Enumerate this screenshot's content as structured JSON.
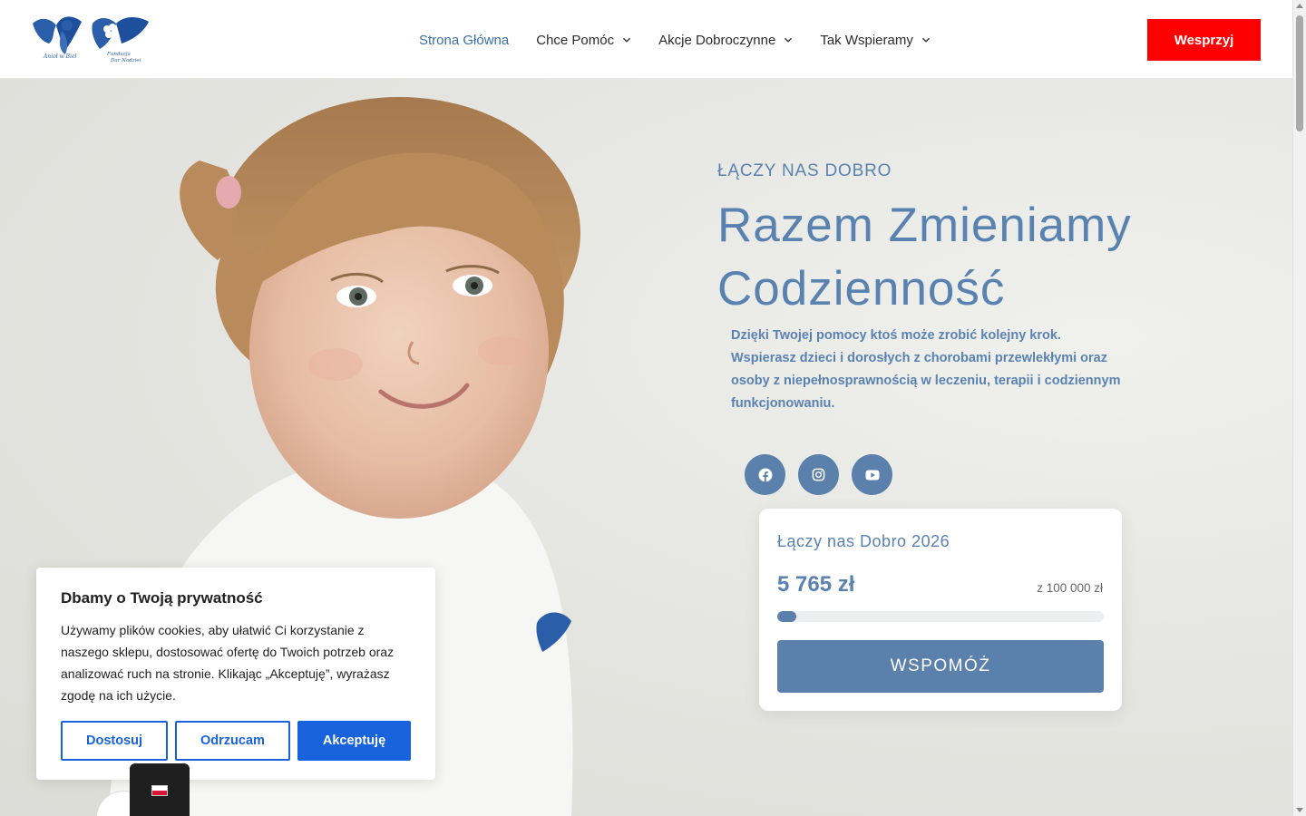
{
  "header": {
    "logo_left_caption": "Anioł w Biel",
    "logo_right_caption": "Fundacja Dar Nadziei",
    "nav": [
      {
        "label": "Strona Główna",
        "active": true,
        "dropdown": false
      },
      {
        "label": "Chce Pomóc",
        "active": false,
        "dropdown": true
      },
      {
        "label": "Akcje Dobroczynne",
        "active": false,
        "dropdown": true
      },
      {
        "label": "Tak Wspieramy",
        "active": false,
        "dropdown": true
      }
    ],
    "donate_label": "Wesprzyj"
  },
  "hero": {
    "kicker": "ŁĄCZY NAS DOBRO",
    "headline_line1": "Razem Zmieniamy",
    "headline_line2": "Codzienność",
    "description": "Dzięki Twojej pomocy ktoś może zrobić kolejny krok. Wspierasz dzieci i dorosłych z chorobami przewlekłymi oraz osoby z niepełnosprawnością w leczeniu, terapii i codziennym funkcjonowaniu.",
    "social": [
      {
        "icon": "facebook-icon"
      },
      {
        "icon": "instagram-icon"
      },
      {
        "icon": "youtube-icon"
      }
    ]
  },
  "campaign": {
    "title": "Łączy nas Dobro 2026",
    "raised": "5 765 zł",
    "goal": "z 100 000 zł",
    "progress_fraction": 0.05765,
    "button_label": "WSPOMÓŻ"
  },
  "cookie": {
    "title": "Dbamy o Twoją prywatność",
    "text": "Używamy plików cookies, aby ułatwić Ci korzystanie z naszego sklepu, dostosować ofertę do Twoich potrzeb oraz analizować ruch na stronie. Klikając „Akceptuję”, wyrażasz zgodę na ich użycie.",
    "customize_label": "Dostosuj",
    "reject_label": "Odrzucam",
    "accept_label": "Akceptuję"
  },
  "language": {
    "flag": "pl-flag"
  },
  "colors": {
    "accent": "#5a82b0",
    "donate": "#ff0000",
    "cookie_primary": "#1863dc"
  }
}
